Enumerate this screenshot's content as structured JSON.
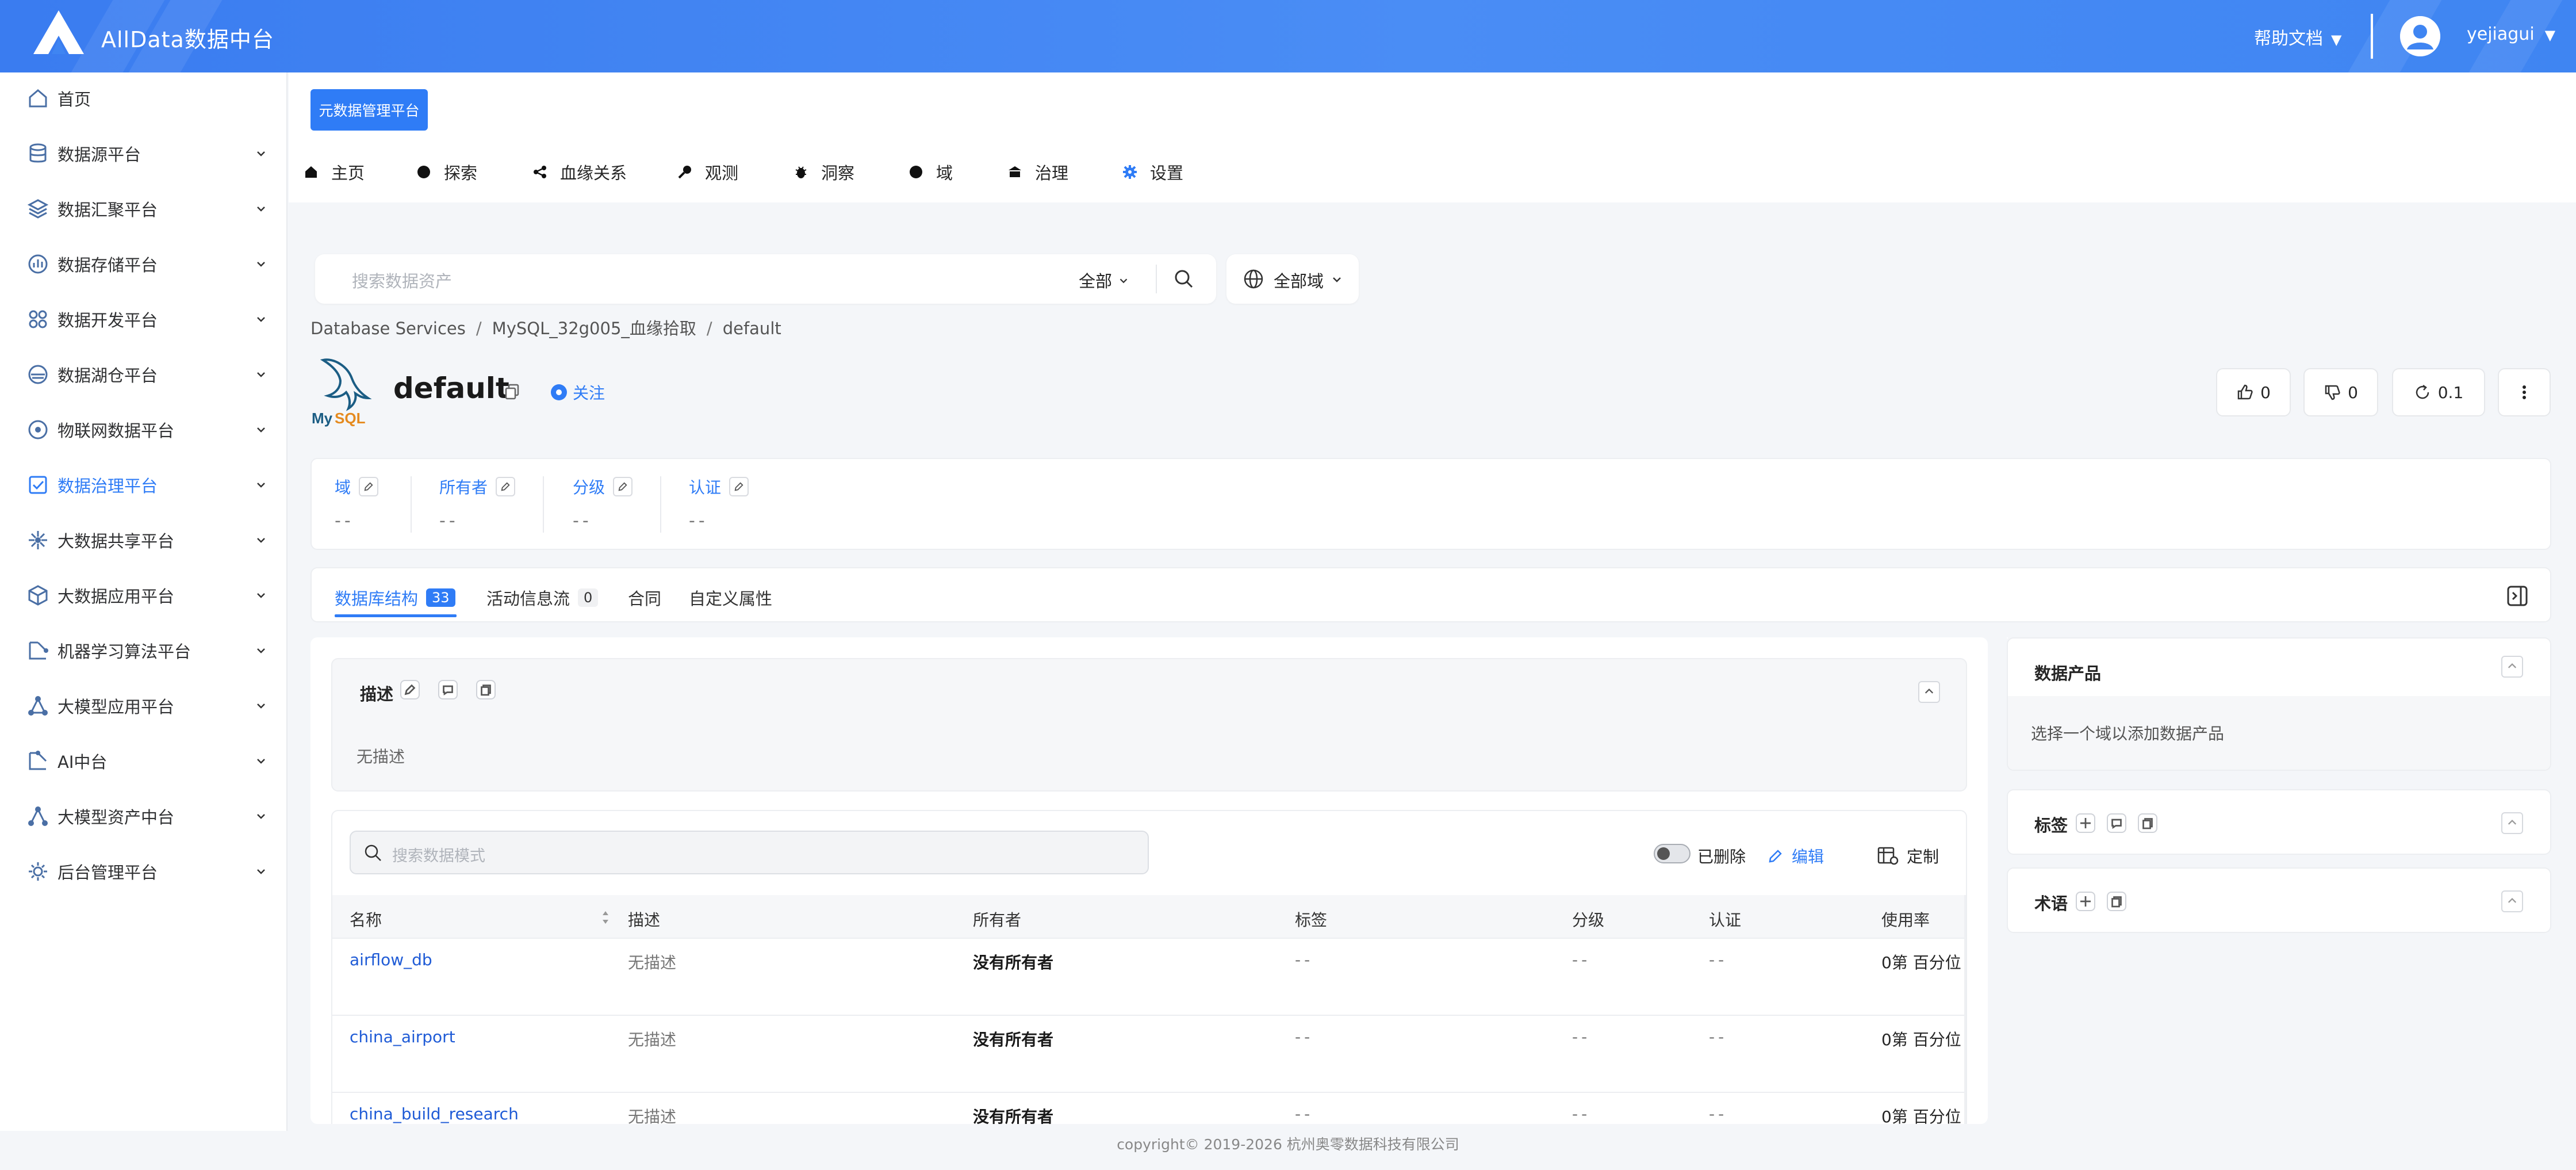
{
  "header": {
    "app_title": "AllData数据中台",
    "help_label": "帮助文档",
    "username": "yejiagui",
    "caret": "▼"
  },
  "sidebar": {
    "items": [
      {
        "label": "首页",
        "icon": "home-icon",
        "expandable": false,
        "active": false
      },
      {
        "label": "数据源平台",
        "icon": "database-icon",
        "expandable": true,
        "active": false
      },
      {
        "label": "数据汇聚平台",
        "icon": "layers-icon",
        "expandable": true,
        "active": false
      },
      {
        "label": "数据存储平台",
        "icon": "chart-icon",
        "expandable": true,
        "active": false
      },
      {
        "label": "数据开发平台",
        "icon": "grid-icon",
        "expandable": true,
        "active": false
      },
      {
        "label": "数据湖仓平台",
        "icon": "lake-icon",
        "expandable": true,
        "active": false
      },
      {
        "label": "物联网数据平台",
        "icon": "iot-icon",
        "expandable": true,
        "active": false
      },
      {
        "label": "数据治理平台",
        "icon": "governance-icon",
        "expandable": true,
        "active": true
      },
      {
        "label": "大数据共享平台",
        "icon": "share-icon",
        "expandable": true,
        "active": false
      },
      {
        "label": "大数据应用平台",
        "icon": "cube-icon",
        "expandable": true,
        "active": false
      },
      {
        "label": "机器学习算法平台",
        "icon": "ml-icon",
        "expandable": true,
        "active": false
      },
      {
        "label": "大模型应用平台",
        "icon": "model-icon",
        "expandable": true,
        "active": false
      },
      {
        "label": "AI中台",
        "icon": "ai-icon",
        "expandable": true,
        "active": false
      },
      {
        "label": "大模型资产中台",
        "icon": "asset-icon",
        "expandable": true,
        "active": false
      },
      {
        "label": "后台管理平台",
        "icon": "settings-icon",
        "expandable": true,
        "active": false
      }
    ]
  },
  "toolbar": {
    "meta_button": "元数据管理平台"
  },
  "nav": {
    "items": [
      {
        "label": "主页",
        "icon": "home-icon"
      },
      {
        "label": "探索",
        "icon": "explore-icon"
      },
      {
        "label": "血缘关系",
        "icon": "lineage-icon"
      },
      {
        "label": "观测",
        "icon": "observe-icon"
      },
      {
        "label": "洞察",
        "icon": "insight-icon"
      },
      {
        "label": "域",
        "icon": "domain-icon"
      },
      {
        "label": "治理",
        "icon": "governance-icon"
      },
      {
        "label": "设置",
        "icon": "gear-icon"
      }
    ]
  },
  "search": {
    "placeholder": "搜索数据资产",
    "scope": "全部",
    "domain_label": "全部域"
  },
  "breadcrumb": [
    "Database Services",
    "MySQL_32g005_血缘拾取",
    "default"
  ],
  "entity": {
    "title": "default",
    "follow_label": "关注",
    "upvotes": "0",
    "downvotes": "0",
    "version": "0.1"
  },
  "properties": [
    {
      "label": "域",
      "value": "--"
    },
    {
      "label": "所有者",
      "value": "--"
    },
    {
      "label": "分级",
      "value": "--"
    },
    {
      "label": "认证",
      "value": "--"
    }
  ],
  "tabs": [
    {
      "label": "数据库结构",
      "badge": "33",
      "active": true
    },
    {
      "label": "活动信息流",
      "badge": "0",
      "active": false
    },
    {
      "label": "合同",
      "badge": "",
      "active": false
    },
    {
      "label": "自定义属性",
      "badge": "",
      "active": false
    }
  ],
  "description": {
    "title": "描述",
    "value": "无描述"
  },
  "schema_table": {
    "search_placeholder": "搜索数据模式",
    "deleted_label": "已删除",
    "edit_label": "编辑",
    "customize_label": "定制",
    "columns": [
      "名称",
      "描述",
      "所有者",
      "标签",
      "分级",
      "认证",
      "使用率"
    ],
    "rows": [
      {
        "name": "airflow_db",
        "description": "无描述",
        "owner": "没有所有者",
        "tags": "--",
        "tier": "--",
        "certification": "--",
        "usage": "0第 百分位"
      },
      {
        "name": "china_airport",
        "description": "无描述",
        "owner": "没有所有者",
        "tags": "--",
        "tier": "--",
        "certification": "--",
        "usage": "0第 百分位"
      },
      {
        "name": "china_build_research",
        "description": "无描述",
        "owner": "没有所有者",
        "tags": "--",
        "tier": "--",
        "certification": "--",
        "usage": "0第 百分位"
      }
    ]
  },
  "right_panel": {
    "data_product_title": "数据产品",
    "data_product_hint": "选择一个域以添加数据产品",
    "tags_title": "标签",
    "glossary_title": "术语"
  },
  "footer": {
    "copyright": "copyright© 2019-2026 杭州奥零数据科技有限公司"
  },
  "colors": {
    "accent": "#2f7cf6",
    "header": "#3f85f2"
  }
}
